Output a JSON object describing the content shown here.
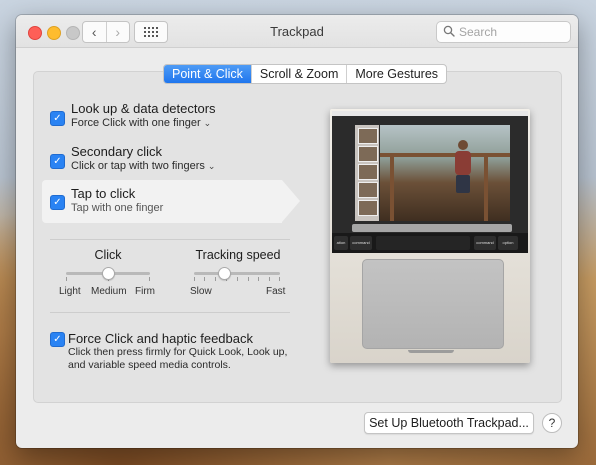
{
  "window": {
    "title": "Trackpad"
  },
  "toolbar": {
    "back_glyph": "‹",
    "forward_glyph": "›",
    "search_placeholder": "Search"
  },
  "tabs": [
    {
      "label": "Point & Click",
      "active": true
    },
    {
      "label": "Scroll & Zoom",
      "active": false
    },
    {
      "label": "More Gestures",
      "active": false
    }
  ],
  "options": [
    {
      "title": "Look up & data detectors",
      "subtitle": "Force Click with one finger",
      "checked": true,
      "has_menu": true
    },
    {
      "title": "Secondary click",
      "subtitle": "Click or tap with two fingers",
      "checked": true,
      "has_menu": true
    },
    {
      "title": "Tap to click",
      "subtitle": "Tap with one finger",
      "checked": true,
      "has_menu": false,
      "selected": true
    }
  ],
  "sliders": {
    "click": {
      "label": "Click",
      "min_label": "Light",
      "mid_label": "Medium",
      "max_label": "Firm",
      "value_fraction": 0.5
    },
    "tracking": {
      "label": "Tracking speed",
      "min_label": "Slow",
      "max_label": "Fast",
      "value_fraction": 0.35
    }
  },
  "force_click": {
    "label": "Force Click and haptic feedback",
    "description": "Click then press firmly for Quick Look, Look up, and variable speed media controls.",
    "checked": true
  },
  "preview": {
    "touchbar_keys": [
      "ation",
      "command",
      "command",
      "option"
    ]
  },
  "footer": {
    "setup_button": "Set Up Bluetooth Trackpad...",
    "help": "?"
  },
  "colors": {
    "accent": "#1f76ee",
    "checkbox": "#2a83f3",
    "window_bg": "#ececec"
  }
}
